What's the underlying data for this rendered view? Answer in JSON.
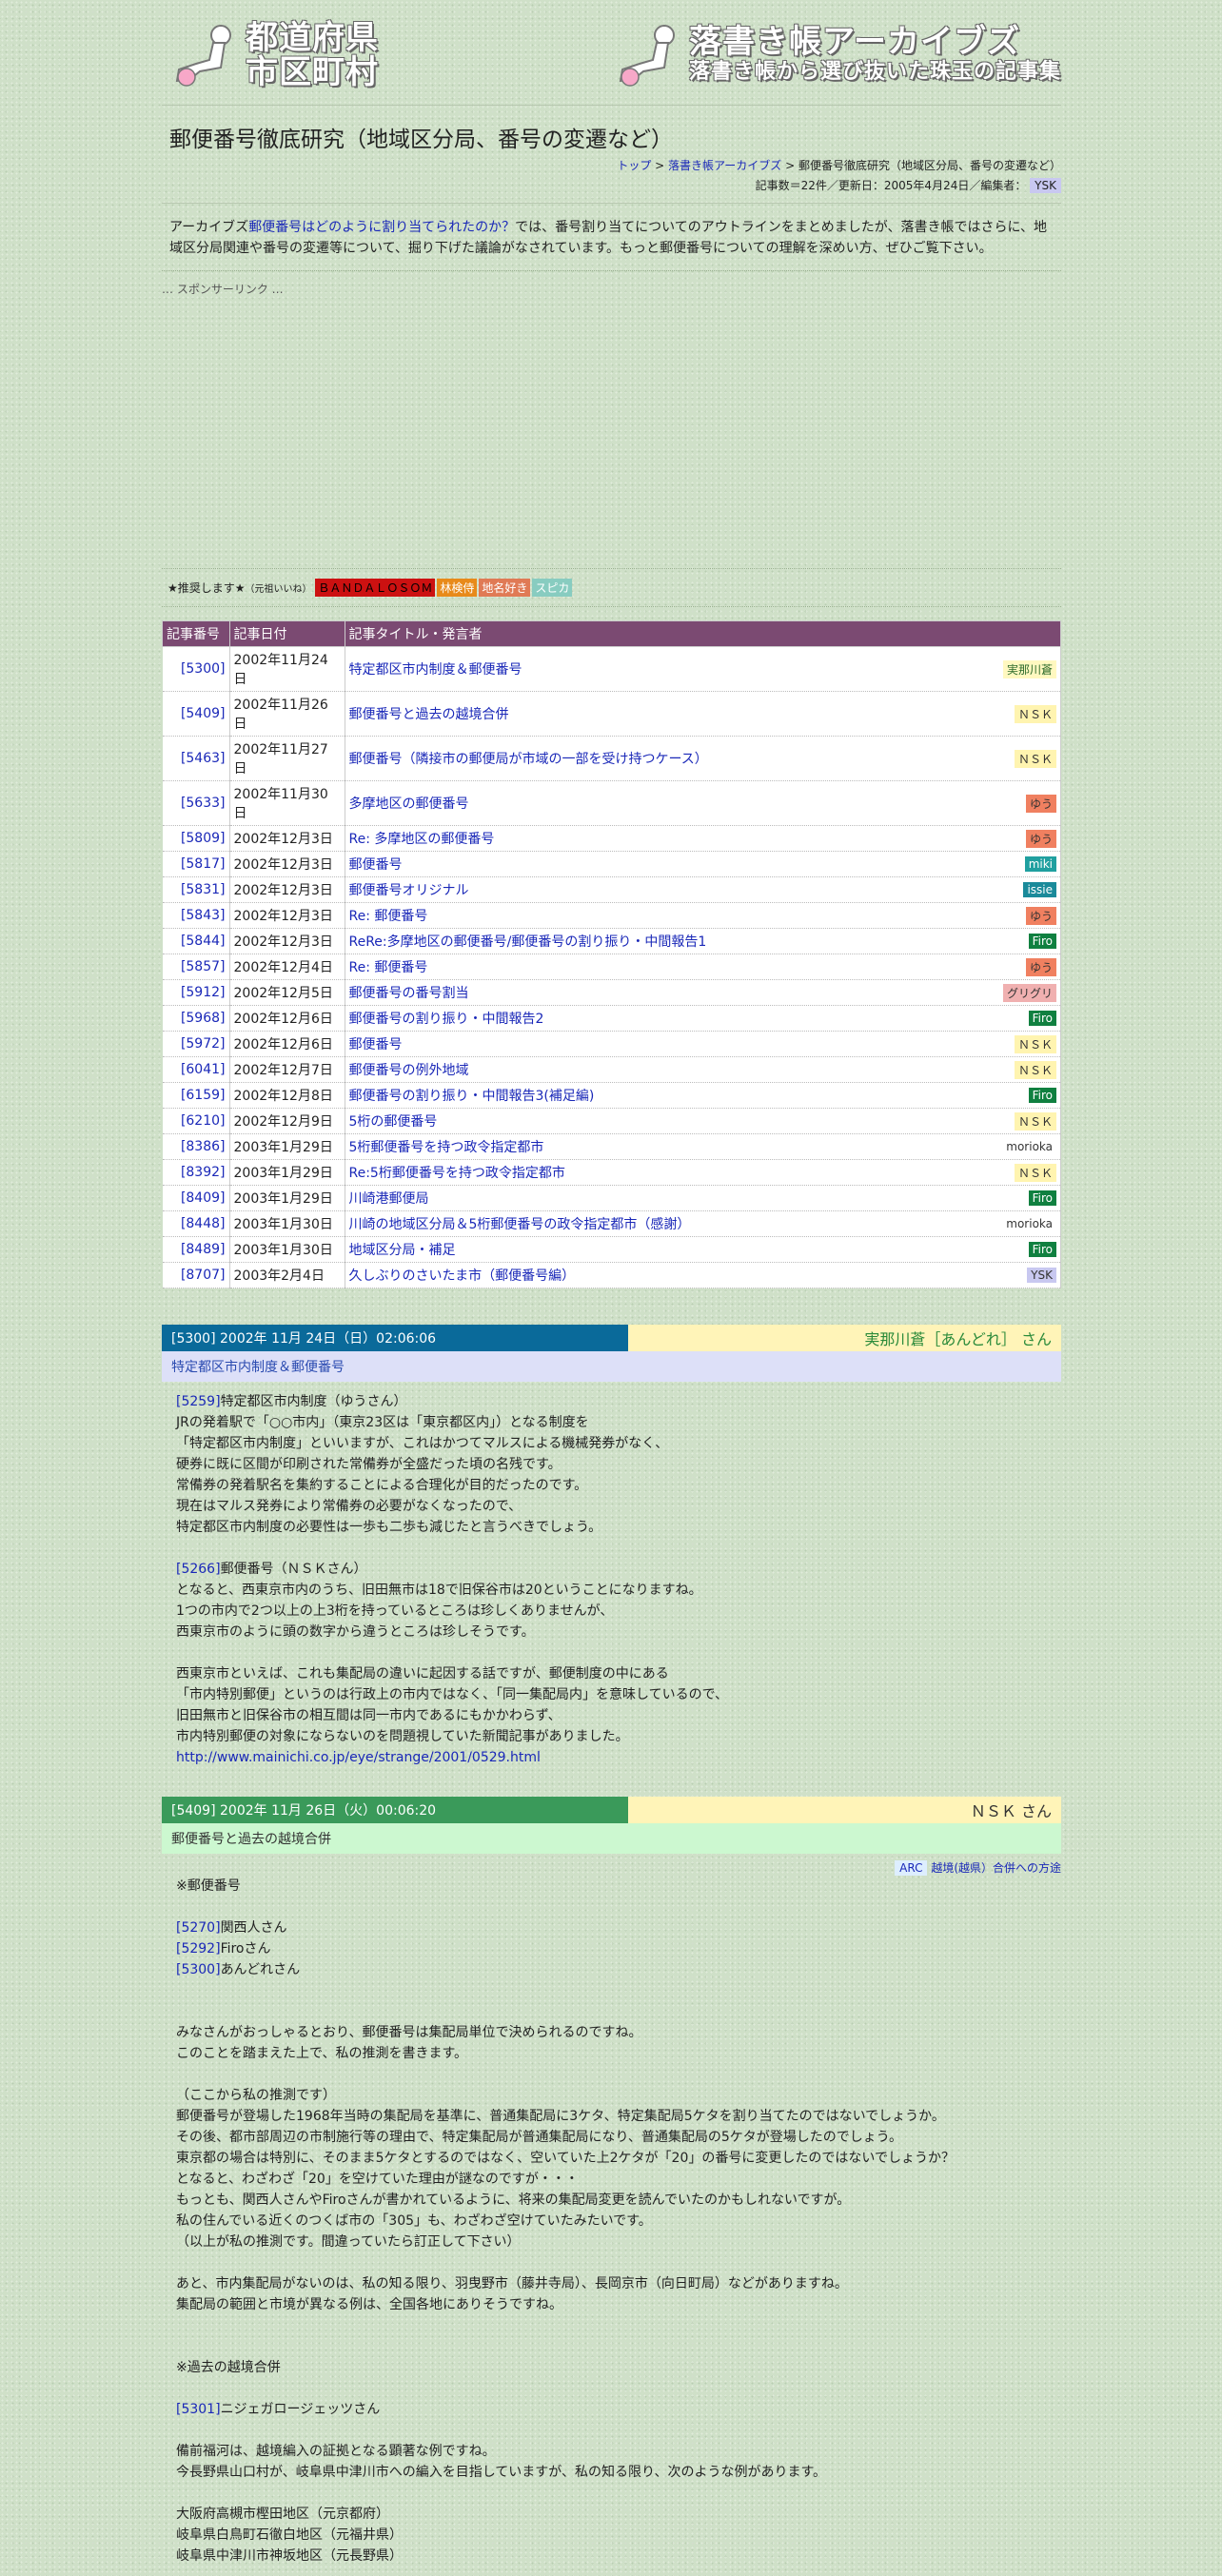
{
  "header": {
    "logo_left_line1": "都道府県",
    "logo_left_line2": "市区町村",
    "logo_right_line1": "落書き帳アーカイブズ",
    "logo_right_line2": "落書き帳から選び抜いた珠玉の記事集"
  },
  "page": {
    "title": "郵便番号徹底研究（地域区分局、番号の変遷など）",
    "breadcrumb": [
      "トップ",
      "落書き帳アーカイブズ",
      "郵便番号徹底研究（地域区分局、番号の変遷など）"
    ],
    "meta": "記事数＝22件／更新日：2005年4月24日／編集者：",
    "editor": "YSK"
  },
  "intro": {
    "prefix": "アーカイブズ",
    "link": "郵便番号はどのように割り当てられたのか？",
    "text": "では、番号割り当てについてのアウトラインをまとめましたが、落書き帳ではさらに、地域区分局関連や番号の変遷等について、掘り下げた議論がなされています。もっと郵便番号についての理解を深めい方、ぜひご覧下さい。"
  },
  "sponsor_label": "… スポンサーリンク …",
  "recs": {
    "label": "★推奨します★",
    "sub": "（元祖いいね）",
    "items": [
      {
        "text": "ＢＡＮＤＡＬＯＳＯＭ",
        "bg": "#cc1111",
        "fg": "#000"
      },
      {
        "text": "林検侍",
        "bg": "#e88a1a",
        "fg": "#fff"
      },
      {
        "text": "地名好き",
        "bg": "#e07a55",
        "fg": "#fff"
      },
      {
        "text": "スピカ",
        "bg": "#88ccc0",
        "fg": "#fff"
      }
    ]
  },
  "table": {
    "headers": [
      "記事番号",
      "記事日付",
      "記事タイトル・発言者"
    ],
    "rows": [
      {
        "num": "[5300]",
        "date": "2002年11月24日",
        "title": "特定都区市内制度＆郵便番号",
        "who": "実那川蒼",
        "bg": "#fff8c0",
        "fg": "#2a6a2a"
      },
      {
        "num": "[5409]",
        "date": "2002年11月26日",
        "title": "郵便番号と過去の越境合併",
        "who": "ＮＳＫ",
        "bg": "#fff4b0",
        "fg": "#333"
      },
      {
        "num": "[5463]",
        "date": "2002年11月27日",
        "title": "郵便番号（隣接市の郵便局が市域の一部を受け持つケース）",
        "who": "ＮＳＫ",
        "bg": "#fff4b0",
        "fg": "#333"
      },
      {
        "num": "[5633]",
        "date": "2002年11月30日",
        "title": "多摩地区の郵便番号",
        "who": "ゆう",
        "bg": "#f08060",
        "fg": "#333"
      },
      {
        "num": "[5809]",
        "date": "2002年12月3日",
        "title": "Re: 多摩地区の郵便番号",
        "who": "ゆう",
        "bg": "#f08060",
        "fg": "#333"
      },
      {
        "num": "[5817]",
        "date": "2002年12月3日",
        "title": "郵便番号",
        "who": "miki",
        "bg": "#20a0a0",
        "fg": "#fff"
      },
      {
        "num": "[5831]",
        "date": "2002年12月3日",
        "title": "郵便番号オリジナル",
        "who": "issie",
        "bg": "#1a8a9a",
        "fg": "#fff"
      },
      {
        "num": "[5843]",
        "date": "2002年12月3日",
        "title": "Re: 郵便番号",
        "who": "ゆう",
        "bg": "#f08060",
        "fg": "#333"
      },
      {
        "num": "[5844]",
        "date": "2002年12月3日",
        "title": "ReRe:多摩地区の郵便番号/郵便番号の割り振り・中間報告1",
        "who": "Firo",
        "bg": "#108040",
        "fg": "#fff"
      },
      {
        "num": "[5857]",
        "date": "2002年12月4日",
        "title": "Re: 郵便番号",
        "who": "ゆう",
        "bg": "#f08060",
        "fg": "#333"
      },
      {
        "num": "[5912]",
        "date": "2002年12月5日",
        "title": "郵便番号の番号割当",
        "who": "グリグリ",
        "bg": "#f0b0b0",
        "fg": "#333"
      },
      {
        "num": "[5968]",
        "date": "2002年12月6日",
        "title": "郵便番号の割り振り・中間報告2",
        "who": "Firo",
        "bg": "#108040",
        "fg": "#fff"
      },
      {
        "num": "[5972]",
        "date": "2002年12月6日",
        "title": "郵便番号",
        "who": "ＮＳＫ",
        "bg": "#fff4b0",
        "fg": "#333"
      },
      {
        "num": "[6041]",
        "date": "2002年12月7日",
        "title": "郵便番号の例外地域",
        "who": "ＮＳＫ",
        "bg": "#fff4b0",
        "fg": "#333"
      },
      {
        "num": "[6159]",
        "date": "2002年12月8日",
        "title": "郵便番号の割り振り・中間報告3(補足編)",
        "who": "Firo",
        "bg": "#108040",
        "fg": "#fff"
      },
      {
        "num": "[6210]",
        "date": "2002年12月9日",
        "title": "5桁の郵便番号",
        "who": "ＮＳＫ",
        "bg": "#fff4b0",
        "fg": "#333"
      },
      {
        "num": "[8386]",
        "date": "2003年1月29日",
        "title": "5桁郵便番号を持つ政令指定都市",
        "who": "morioka",
        "bg": "#ffffff",
        "fg": "#333"
      },
      {
        "num": "[8392]",
        "date": "2003年1月29日",
        "title": "Re:5桁郵便番号を持つ政令指定都市",
        "who": "ＮＳＫ",
        "bg": "#fff4b0",
        "fg": "#333"
      },
      {
        "num": "[8409]",
        "date": "2003年1月29日",
        "title": "川崎港郵便局",
        "who": "Firo",
        "bg": "#108040",
        "fg": "#fff"
      },
      {
        "num": "[8448]",
        "date": "2003年1月30日",
        "title": "川崎の地域区分局＆5桁郵便番号の政令指定都市（感謝）",
        "who": "morioka",
        "bg": "#ffffff",
        "fg": "#333"
      },
      {
        "num": "[8489]",
        "date": "2003年1月30日",
        "title": "地域区分局・補足",
        "who": "Firo",
        "bg": "#108040",
        "fg": "#fff"
      },
      {
        "num": "[8707]",
        "date": "2003年2月4日",
        "title": "久しぶりのさいたま市（郵便番号編）",
        "who": "YSK",
        "bg": "#c8c8f0",
        "fg": "#333"
      }
    ]
  },
  "post1": {
    "head": "[5300] 2002年 11月 24日（日）02:06:06",
    "author": "実那川蒼［あんどれ］ さん",
    "subject": "特定都区市内制度＆郵便番号",
    "head_bg": "#0a6a9a",
    "sub_bg": "#dde0f8",
    "ref1_link": "[5259]",
    "ref1_text": "特定都区市内制度（ゆうさん）",
    "para1": [
      "JRの発着駅で「○○市内」（東京23区は「東京都区内」）となる制度を",
      "「特定都区市内制度」といいますが、これはかつてマルスによる機械発券がなく、",
      "硬券に既に区間が印刷された常備券が全盛だった頃の名残です。",
      "常備券の発着駅名を集約することによる合理化が目的だったのです。",
      "現在はマルス発券により常備券の必要がなくなったので、",
      "特定都区市内制度の必要性は一歩も二歩も減じたと言うべきでしょう。"
    ],
    "ref2_link": "[5266]",
    "ref2_text": "郵便番号（ＮＳＫさん）",
    "para2": [
      "となると、西東京市内のうち、旧田無市は18で旧保谷市は20ということになりますね。",
      "1つの市内で2つ以上の上3桁を持っているところは珍しくありませんが、",
      "西東京市のように頭の数字から違うところは珍しそうです。"
    ],
    "para3": [
      "西東京市といえば、これも集配局の違いに起因する話ですが、郵便制度の中にある",
      "「市内特別郵便」というのは行政上の市内ではなく、「同一集配局内」を意味しているので、",
      "旧田無市と旧保谷市の相互間は同一市内であるにもかかわらず、",
      "市内特別郵便の対象にならないのを問題視していた新聞記事がありました。"
    ],
    "url": "http://www.mainichi.co.jp/eye/strange/2001/0529.html"
  },
  "post2": {
    "head": "[5409] 2002年 11月 26日（火）00:06:20",
    "author": "ＮＳＫ さん",
    "subject": "郵便番号と過去の越境合併",
    "head_bg": "#3a9a5a",
    "sub_bg": "#ccf8d0",
    "arc_label": "ARC",
    "arc_link": "越境(越県）合併への方途",
    "line_title": "※郵便番号",
    "refs": [
      {
        "link": "[5270]",
        "text": "関西人さん"
      },
      {
        "link": "[5292]",
        "text": "Firoさん"
      },
      {
        "link": "[5300]",
        "text": "あんどれさん"
      }
    ],
    "para1": [
      "みなさんがおっしゃるとおり、郵便番号は集配局単位で決められるのですね。",
      "このことを踏まえた上で、私の推測を書きます。"
    ],
    "para2": [
      "（ここから私の推測です）",
      "郵便番号が登場した1968年当時の集配局を基準に、普通集配局に3ケタ、特定集配局5ケタを割り当てたのではないでしょうか。",
      "その後、都市部周辺の市制施行等の理由で、特定集配局が普通集配局になり、普通集配局の5ケタが登場したのでしょう。",
      "東京都の場合は特別に、そのまま5ケタとするのではなく、空いていた上2ケタが「20」の番号に変更したのではないでしょうか？",
      "となると、わざわざ「20」を空けていた理由が謎なのですが・・・",
      "もっとも、関西人さんやFiroさんが書かれているように、将来の集配局変更を読んでいたのかもしれないですが。",
      "私の住んでいる近くのつくば市の「305」も、わざわざ空けていたみたいです。",
      "（以上が私の推測です。間違っていたら訂正して下さい）"
    ],
    "para3": [
      "あと、市内集配局がないのは、私の知る限り、羽曳野市（藤井寺局）、長岡京市（向日町局）などがありますね。",
      "集配局の範囲と市境が異なる例は、全国各地にありそうですね。"
    ],
    "section2": "※過去の越境合併",
    "ref4_link": "[5301]",
    "ref4_text": "ニジェガロージェッツさん",
    "para4": [
      "備前福河は、越境編入の証拠となる顕著な例ですね。",
      "今長野県山口村が、岐阜県中津川市への編入を目指していますが、私の知る限り、次のような例があります。"
    ],
    "para5": [
      "大阪府高槻市樫田地区（元京都府）",
      "岐阜県白鳥町石徹白地区（元福井県）",
      "岐阜県中津川市神坂地区（元長野県）"
    ]
  }
}
